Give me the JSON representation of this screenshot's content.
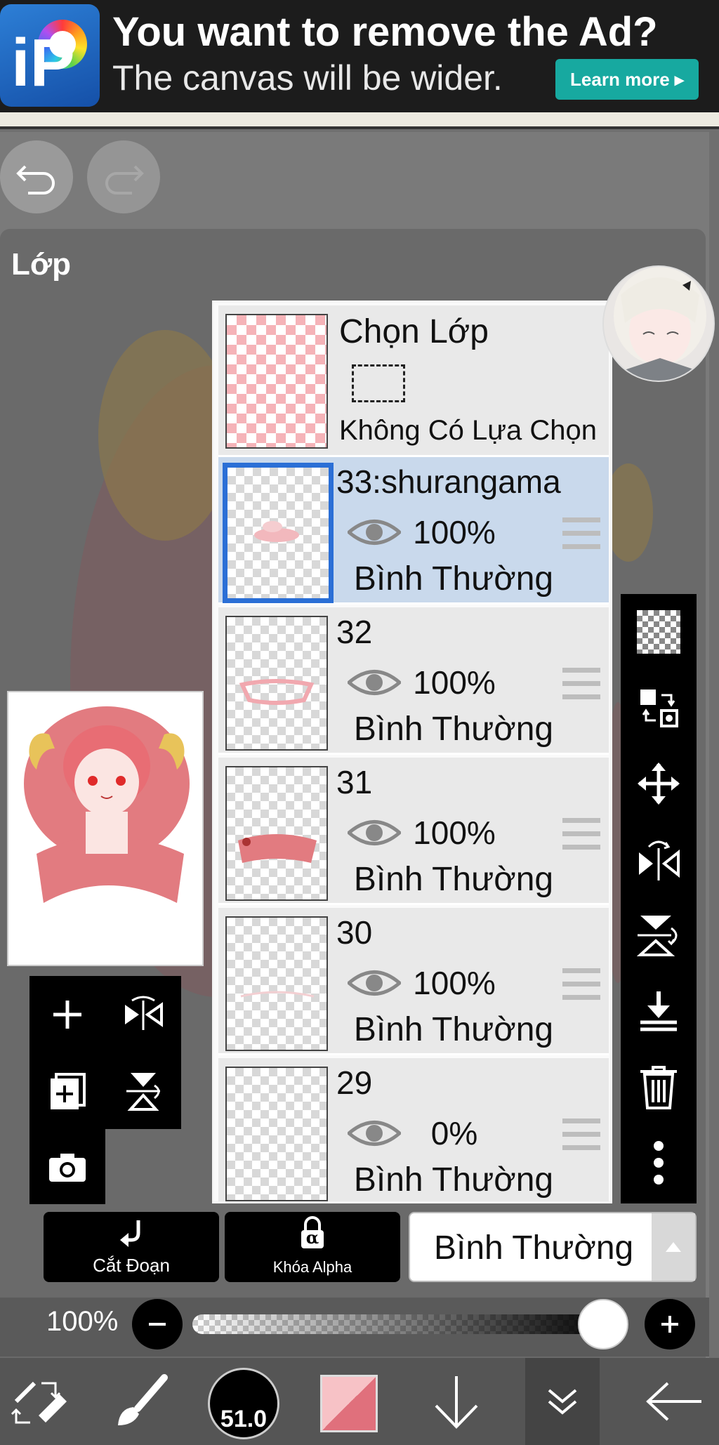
{
  "ad": {
    "headline": "You want to remove the Ad?",
    "subline": "The canvas will be wider.",
    "cta": "Learn more ▸",
    "logo_text": "iP"
  },
  "panel": {
    "title": "Lớp"
  },
  "selection_layer": {
    "title": "Chọn Lớp",
    "subtitle": "Không Có Lựa Chọn"
  },
  "layers": [
    {
      "name": "33:shurangama",
      "opacity": "100%",
      "blend": "Bình Thường",
      "selected": true
    },
    {
      "name": "32",
      "opacity": "100%",
      "blend": "Bình Thường",
      "selected": false
    },
    {
      "name": "31",
      "opacity": "100%",
      "blend": "Bình Thường",
      "selected": false
    },
    {
      "name": "30",
      "opacity": "100%",
      "blend": "Bình Thường",
      "selected": false
    },
    {
      "name": "29",
      "opacity": "0%",
      "blend": "Bình Thường",
      "selected": false
    }
  ],
  "buttons": {
    "clip": "Cắt Đoạn",
    "alpha_lock": "Khóa Alpha",
    "alpha_symbol": "α"
  },
  "blend_mode": {
    "value": "Bình Thường"
  },
  "opacity_slider": {
    "label": "100%",
    "value": 1.0
  },
  "brush_size": {
    "value": "51.0"
  },
  "colors": {
    "accent": "#2b6fd6",
    "selected_row": "#c9d9ec",
    "ad_button": "#17a9a0",
    "primary_color": "#e0707c",
    "secondary_color": "#f7c2c6"
  },
  "icons": {
    "undo": "undo-icon",
    "redo": "redo-icon",
    "add_layer": "plus-icon",
    "flip_h": "flip-horizontal-icon",
    "duplicate": "duplicate-layer-icon",
    "flip_v": "flip-vertical-icon",
    "camera": "camera-icon",
    "transparency": "checkerboard-icon",
    "select_swap": "selection-swap-icon",
    "move": "move-icon",
    "mirror": "mirror-rotate-icon",
    "flip_rotate": "flip-rotate-icon",
    "merge_down": "merge-down-icon",
    "delete": "trash-icon",
    "more": "more-vertical-icon",
    "tool": "tool-select-icon",
    "brush": "brush-icon",
    "down": "arrow-down-icon",
    "layers": "layers-chevron-icon",
    "back": "arrow-left-icon"
  }
}
